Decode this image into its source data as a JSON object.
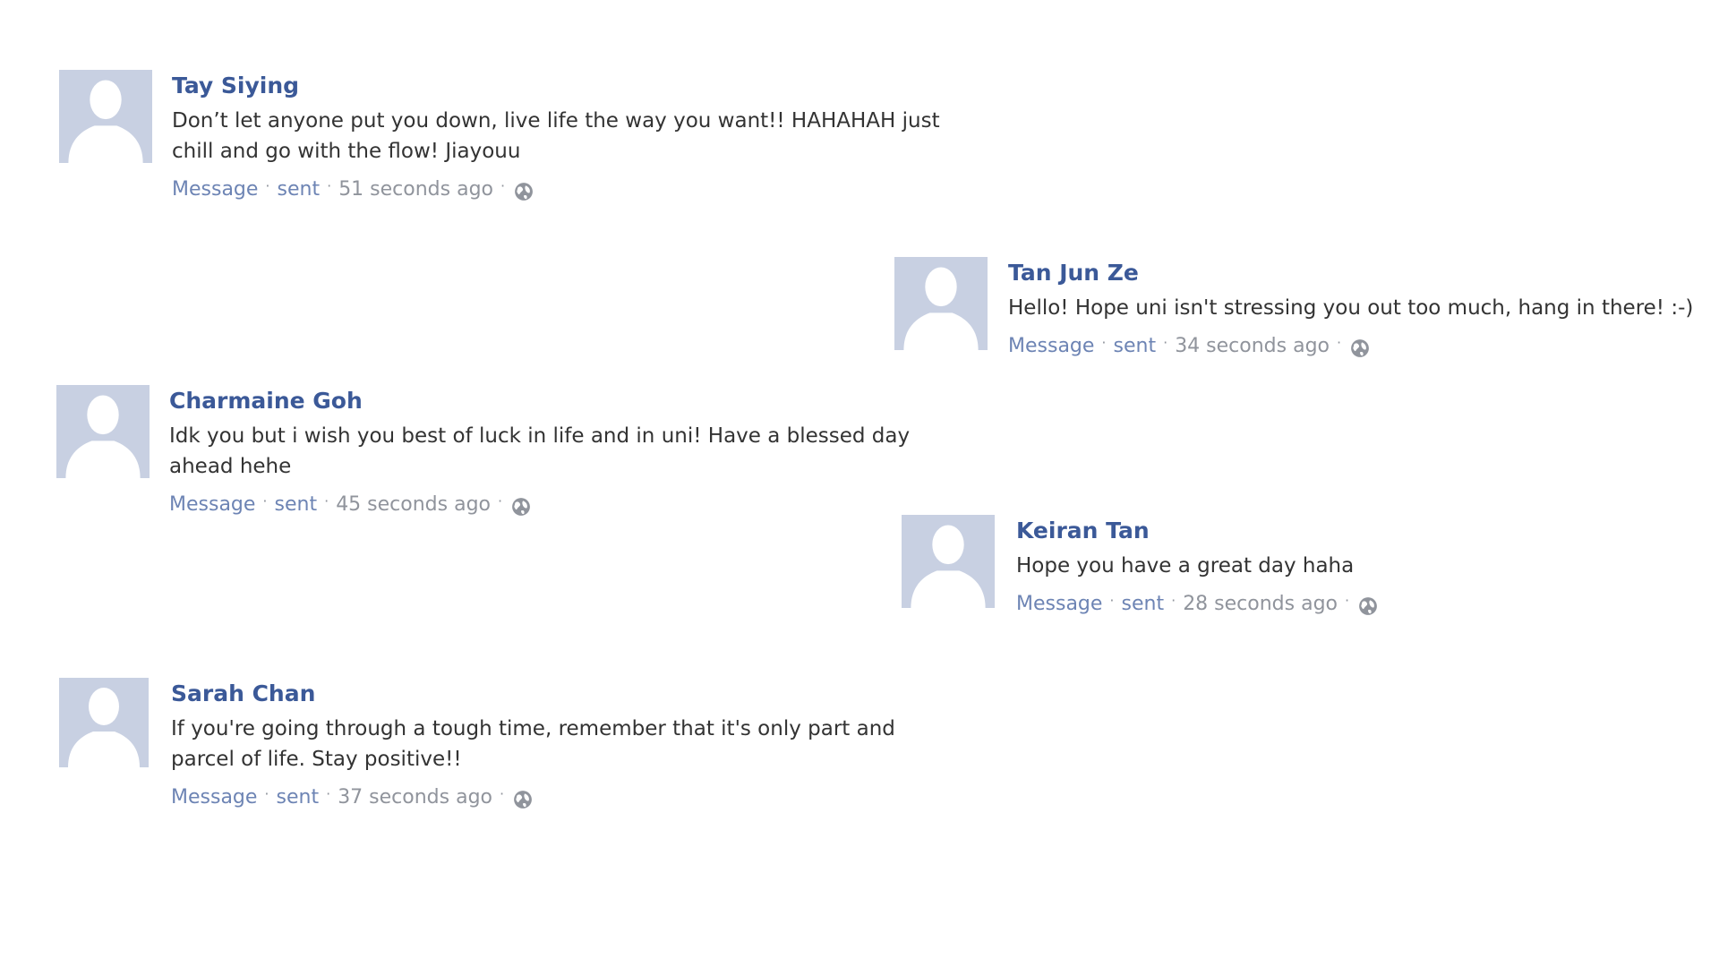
{
  "icons": {
    "avatar": "default-profile-silhouette-icon",
    "audience": "globe-icon"
  },
  "colors": {
    "name": "#3b5998",
    "link": "#6d84b4",
    "meta": "#90949c",
    "text": "#333333",
    "avatar_bg": "#c8d0e2"
  },
  "posts": [
    {
      "name": "Tay Siying",
      "text": "Don’t let anyone put you down, live life the way you want!! HAHAHAH just chill and go with the flow! Jiayouu",
      "message_label": "Message",
      "sent_label": "sent",
      "time": "51 seconds ago"
    },
    {
      "name": "Tan Jun Ze",
      "text": "Hello! Hope uni isn't stressing you out too much, hang in there! :-)",
      "message_label": "Message",
      "sent_label": "sent",
      "time": "34 seconds ago"
    },
    {
      "name": "Charmaine Goh",
      "text": "Idk you but i wish you best of luck in life and in uni! Have a blessed day ahead hehe",
      "message_label": "Message",
      "sent_label": "sent",
      "time": "45 seconds ago"
    },
    {
      "name": "Keiran Tan",
      "text": "Hope you have a great day haha",
      "message_label": "Message",
      "sent_label": "sent",
      "time": "28 seconds ago"
    },
    {
      "name": "Sarah Chan",
      "text": "If you're going through a tough time, remember that it's only part and parcel of life. Stay positive!!",
      "message_label": "Message",
      "sent_label": "sent",
      "time": "37 seconds ago"
    }
  ]
}
